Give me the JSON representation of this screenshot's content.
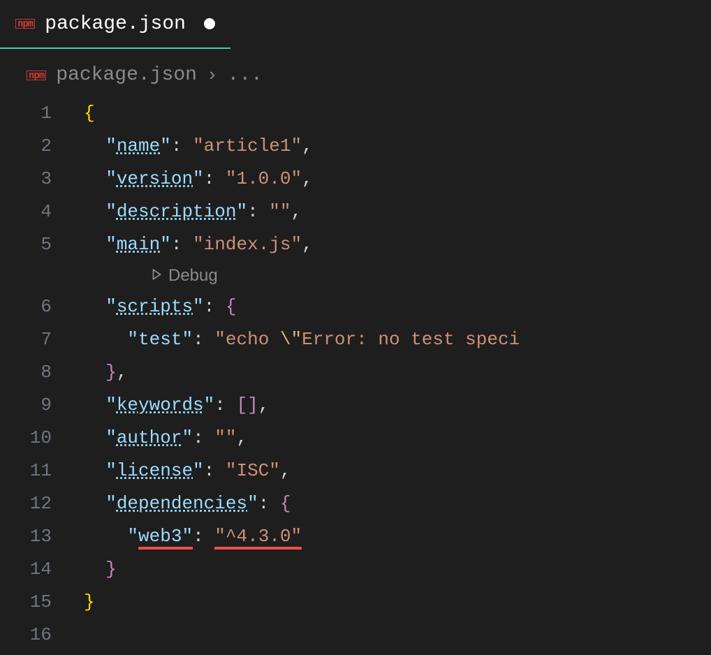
{
  "tab": {
    "filename": "package.json",
    "modified": true
  },
  "breadcrumb": {
    "filename": "package.json",
    "rest": "..."
  },
  "codelens": {
    "debug": "Debug"
  },
  "lines": [
    {
      "n": "1",
      "indent": 0,
      "tokens": [
        {
          "t": "{",
          "c": "brace-yellow"
        }
      ]
    },
    {
      "n": "2",
      "indent": 1,
      "tokens": [
        {
          "t": "\"",
          "c": "quote-key"
        },
        {
          "t": "name",
          "c": "key-clickable"
        },
        {
          "t": "\"",
          "c": "quote-key"
        },
        {
          "t": ": ",
          "c": "punct"
        },
        {
          "t": "\"article1\"",
          "c": "string"
        },
        {
          "t": ",",
          "c": "punct"
        }
      ]
    },
    {
      "n": "3",
      "indent": 1,
      "tokens": [
        {
          "t": "\"",
          "c": "quote-key"
        },
        {
          "t": "version",
          "c": "key-clickable"
        },
        {
          "t": "\"",
          "c": "quote-key"
        },
        {
          "t": ": ",
          "c": "punct"
        },
        {
          "t": "\"1.0.0\"",
          "c": "string"
        },
        {
          "t": ",",
          "c": "punct"
        }
      ]
    },
    {
      "n": "4",
      "indent": 1,
      "tokens": [
        {
          "t": "\"",
          "c": "quote-key"
        },
        {
          "t": "description",
          "c": "key-clickable"
        },
        {
          "t": "\"",
          "c": "quote-key"
        },
        {
          "t": ": ",
          "c": "punct"
        },
        {
          "t": "\"\"",
          "c": "string"
        },
        {
          "t": ",",
          "c": "punct"
        }
      ]
    },
    {
      "n": "5",
      "indent": 1,
      "tokens": [
        {
          "t": "\"",
          "c": "quote-key"
        },
        {
          "t": "main",
          "c": "key-clickable"
        },
        {
          "t": "\"",
          "c": "quote-key"
        },
        {
          "t": ": ",
          "c": "punct"
        },
        {
          "t": "\"index.js\"",
          "c": "string"
        },
        {
          "t": ",",
          "c": "punct"
        }
      ]
    },
    {
      "n": "6",
      "indent": 1,
      "tokens": [
        {
          "t": "\"",
          "c": "quote-key"
        },
        {
          "t": "scripts",
          "c": "key-clickable"
        },
        {
          "t": "\"",
          "c": "quote-key"
        },
        {
          "t": ": ",
          "c": "punct"
        },
        {
          "t": "{",
          "c": "brace-purple"
        }
      ]
    },
    {
      "n": "7",
      "indent": 2,
      "tokens": [
        {
          "t": "\"",
          "c": "quote-key"
        },
        {
          "t": "test",
          "c": "key"
        },
        {
          "t": "\"",
          "c": "quote-key"
        },
        {
          "t": ": ",
          "c": "punct"
        },
        {
          "t": "\"echo ",
          "c": "string"
        },
        {
          "t": "\\\"",
          "c": "escape"
        },
        {
          "t": "Error: no test speci",
          "c": "string"
        }
      ]
    },
    {
      "n": "8",
      "indent": 1,
      "tokens": [
        {
          "t": "}",
          "c": "brace-purple"
        },
        {
          "t": ",",
          "c": "punct"
        }
      ]
    },
    {
      "n": "9",
      "indent": 1,
      "tokens": [
        {
          "t": "\"",
          "c": "quote-key"
        },
        {
          "t": "keywords",
          "c": "key-clickable"
        },
        {
          "t": "\"",
          "c": "quote-key"
        },
        {
          "t": ": ",
          "c": "punct"
        },
        {
          "t": "[]",
          "c": "brace-purple"
        },
        {
          "t": ",",
          "c": "punct"
        }
      ]
    },
    {
      "n": "10",
      "indent": 1,
      "tokens": [
        {
          "t": "\"",
          "c": "quote-key"
        },
        {
          "t": "author",
          "c": "key-clickable"
        },
        {
          "t": "\"",
          "c": "quote-key"
        },
        {
          "t": ": ",
          "c": "punct"
        },
        {
          "t": "\"\"",
          "c": "string"
        },
        {
          "t": ",",
          "c": "punct"
        }
      ]
    },
    {
      "n": "11",
      "indent": 1,
      "tokens": [
        {
          "t": "\"",
          "c": "quote-key"
        },
        {
          "t": "license",
          "c": "key-clickable"
        },
        {
          "t": "\"",
          "c": "quote-key"
        },
        {
          "t": ": ",
          "c": "punct"
        },
        {
          "t": "\"ISC\"",
          "c": "string"
        },
        {
          "t": ",",
          "c": "punct"
        }
      ]
    },
    {
      "n": "12",
      "indent": 1,
      "tokens": [
        {
          "t": "\"",
          "c": "quote-key"
        },
        {
          "t": "dependencies",
          "c": "key-clickable"
        },
        {
          "t": "\"",
          "c": "quote-key"
        },
        {
          "t": ": ",
          "c": "punct"
        },
        {
          "t": "{",
          "c": "brace-purple"
        }
      ]
    },
    {
      "n": "13",
      "indent": 2,
      "tokens": [
        {
          "t": "\"",
          "c": "quote-key"
        },
        {
          "t": "web3",
          "c": "key",
          "u": true
        },
        {
          "t": "\"",
          "c": "quote-key",
          "u": true
        },
        {
          "t": ": ",
          "c": "punct"
        },
        {
          "t": "\"^4.3.0\"",
          "c": "string",
          "u": true
        }
      ]
    },
    {
      "n": "14",
      "indent": 1,
      "tokens": [
        {
          "t": "}",
          "c": "brace-purple"
        }
      ]
    },
    {
      "n": "15",
      "indent": 0,
      "tokens": [
        {
          "t": "}",
          "c": "brace-yellow"
        }
      ]
    },
    {
      "n": "16",
      "indent": 0,
      "tokens": []
    }
  ]
}
